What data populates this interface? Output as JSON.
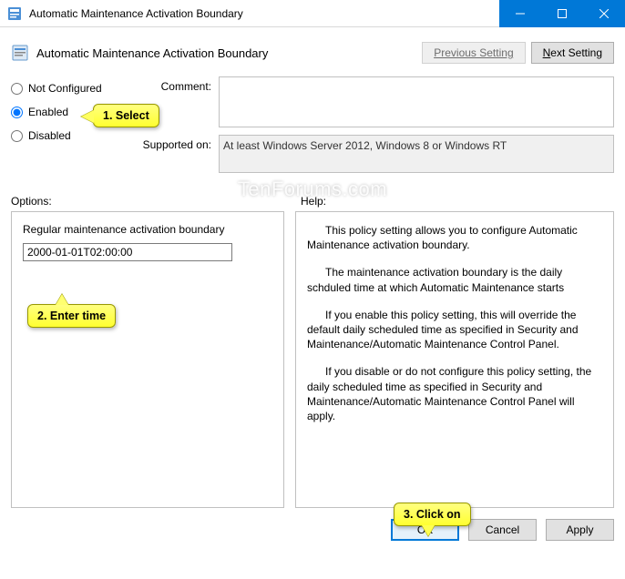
{
  "window": {
    "title": "Automatic Maintenance Activation Boundary"
  },
  "header": {
    "title": "Automatic Maintenance Activation Boundary",
    "prev_label": "Previous Setting",
    "next_label": "Next Setting"
  },
  "radio": {
    "not_configured": "Not Configured",
    "enabled": "Enabled",
    "disabled": "Disabled",
    "selected": "enabled"
  },
  "fields": {
    "comment_label": "Comment:",
    "comment_value": "",
    "supported_label": "Supported on:",
    "supported_value": "At least Windows Server 2012, Windows 8 or Windows RT"
  },
  "labels": {
    "options": "Options:",
    "help": "Help:"
  },
  "options": {
    "label": "Regular maintenance activation boundary",
    "value": "2000-01-01T02:00:00"
  },
  "help": {
    "p1": "This policy setting allows you to configure Automatic Maintenance activation boundary.",
    "p2": "The maintenance activation boundary is the daily schduled time at which Automatic Maintenance starts",
    "p3": "If you enable this policy setting, this will override the default daily scheduled time as specified in Security and Maintenance/Automatic Maintenance Control Panel.",
    "p4": "If you disable or do not configure this policy setting, the daily scheduled time as specified in Security and Maintenance/Automatic Maintenance Control Panel will apply."
  },
  "buttons": {
    "ok": "OK",
    "cancel": "Cancel",
    "apply": "Apply"
  },
  "callouts": {
    "c1": "1. Select",
    "c2": "2. Enter time",
    "c3": "3. Click on"
  },
  "watermark": "TenForums.com"
}
